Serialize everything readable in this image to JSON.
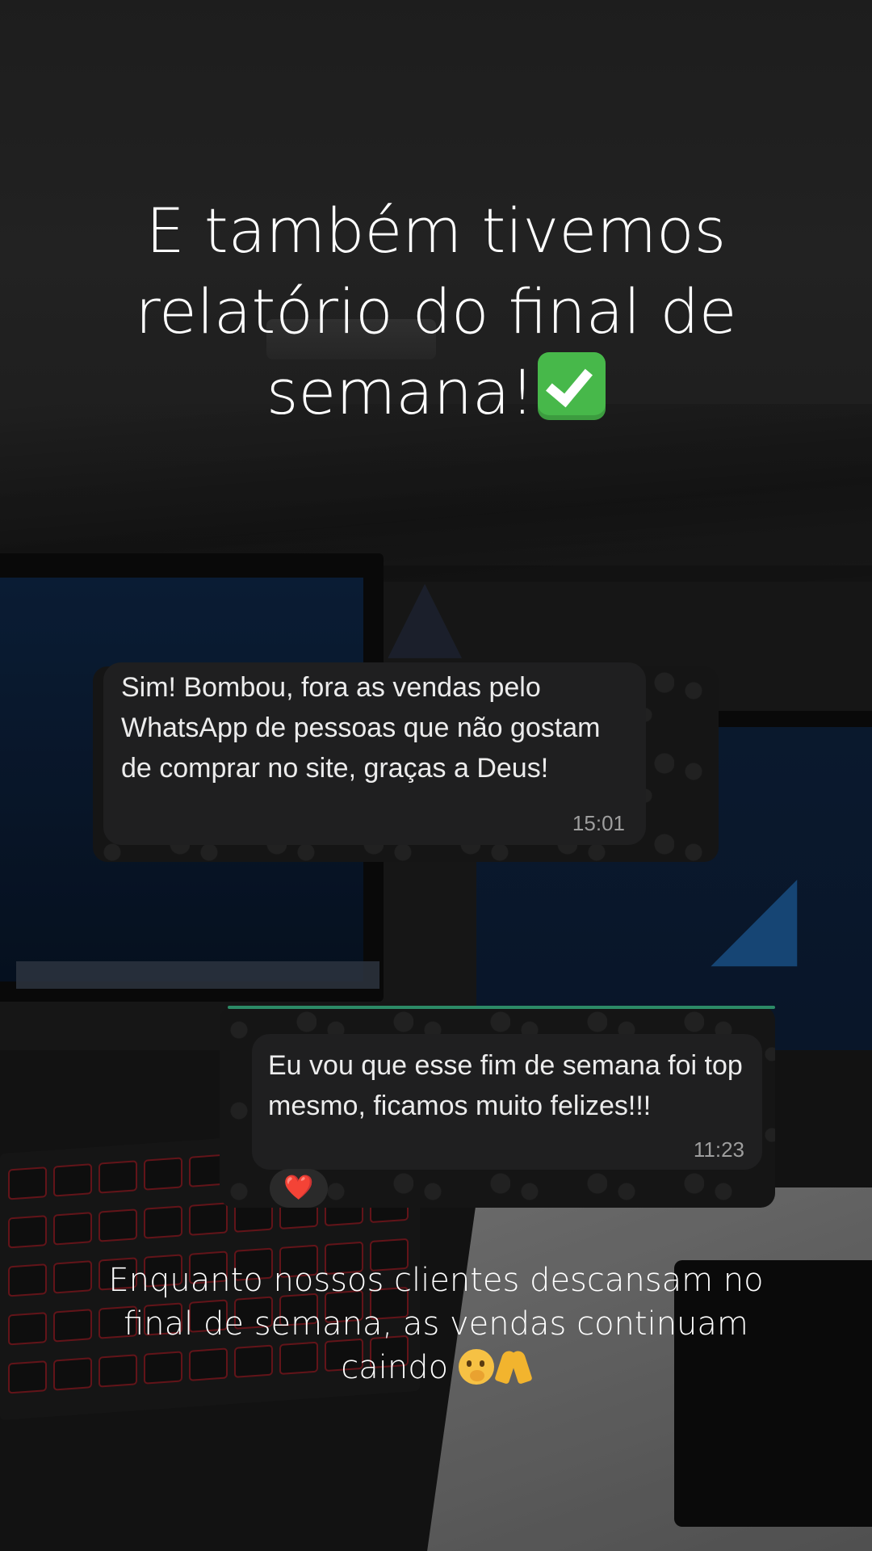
{
  "story": {
    "title": "E também tivemos relatório do final de semana!",
    "title_emoji": "check-mark-button-icon",
    "caption": "Enquanto nossos clientes descansam no final de semana, as vendas continuam caindo",
    "caption_emojis": [
      "face-with-hand-over-mouth-icon",
      "folded-hands-icon"
    ]
  },
  "messages": [
    {
      "text": "Sim! Bombou, fora as vendas pelo WhatsApp de pessoas que não gostam de comprar no site, graças a Deus!",
      "time": "15:01",
      "direction": "incoming"
    },
    {
      "text": "Eu vou que esse fim de semana foi top mesmo, ficamos muito felizes!!!",
      "time": "11:23",
      "direction": "incoming",
      "reaction": "❤️"
    }
  ],
  "colors": {
    "bubble": "#1f1f20",
    "text": "#ececec",
    "timestamp": "#9e9e9e",
    "check_emoji": "#47b84a",
    "heart": "#e0253a"
  }
}
